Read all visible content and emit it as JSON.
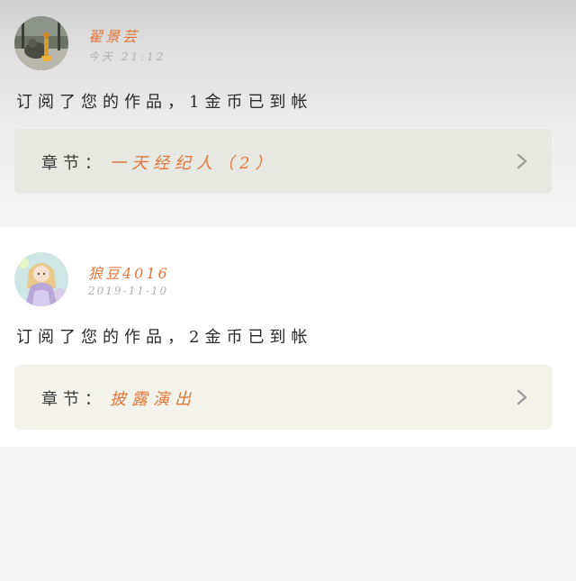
{
  "theme": {
    "accent": "#e0773a",
    "chevron_color": "#9a9a9a"
  },
  "notifications": [
    {
      "username": "翟景芸",
      "timestamp": "今天  21:12",
      "message": "订阅了您的作品，1金币已到帐",
      "chapter_label": "章节：",
      "chapter_title": "一天经纪人（2）",
      "avatar_icon": "avatar-photo-icon",
      "chevron_icon": "chevron-right-icon"
    },
    {
      "username": "狼豆4016",
      "timestamp": "2019-11-10",
      "message": "订阅了您的作品，2金币已到帐",
      "chapter_label": "章节：",
      "chapter_title": "披露演出",
      "avatar_icon": "avatar-anime-girl-icon",
      "chevron_icon": "chevron-right-icon"
    }
  ]
}
